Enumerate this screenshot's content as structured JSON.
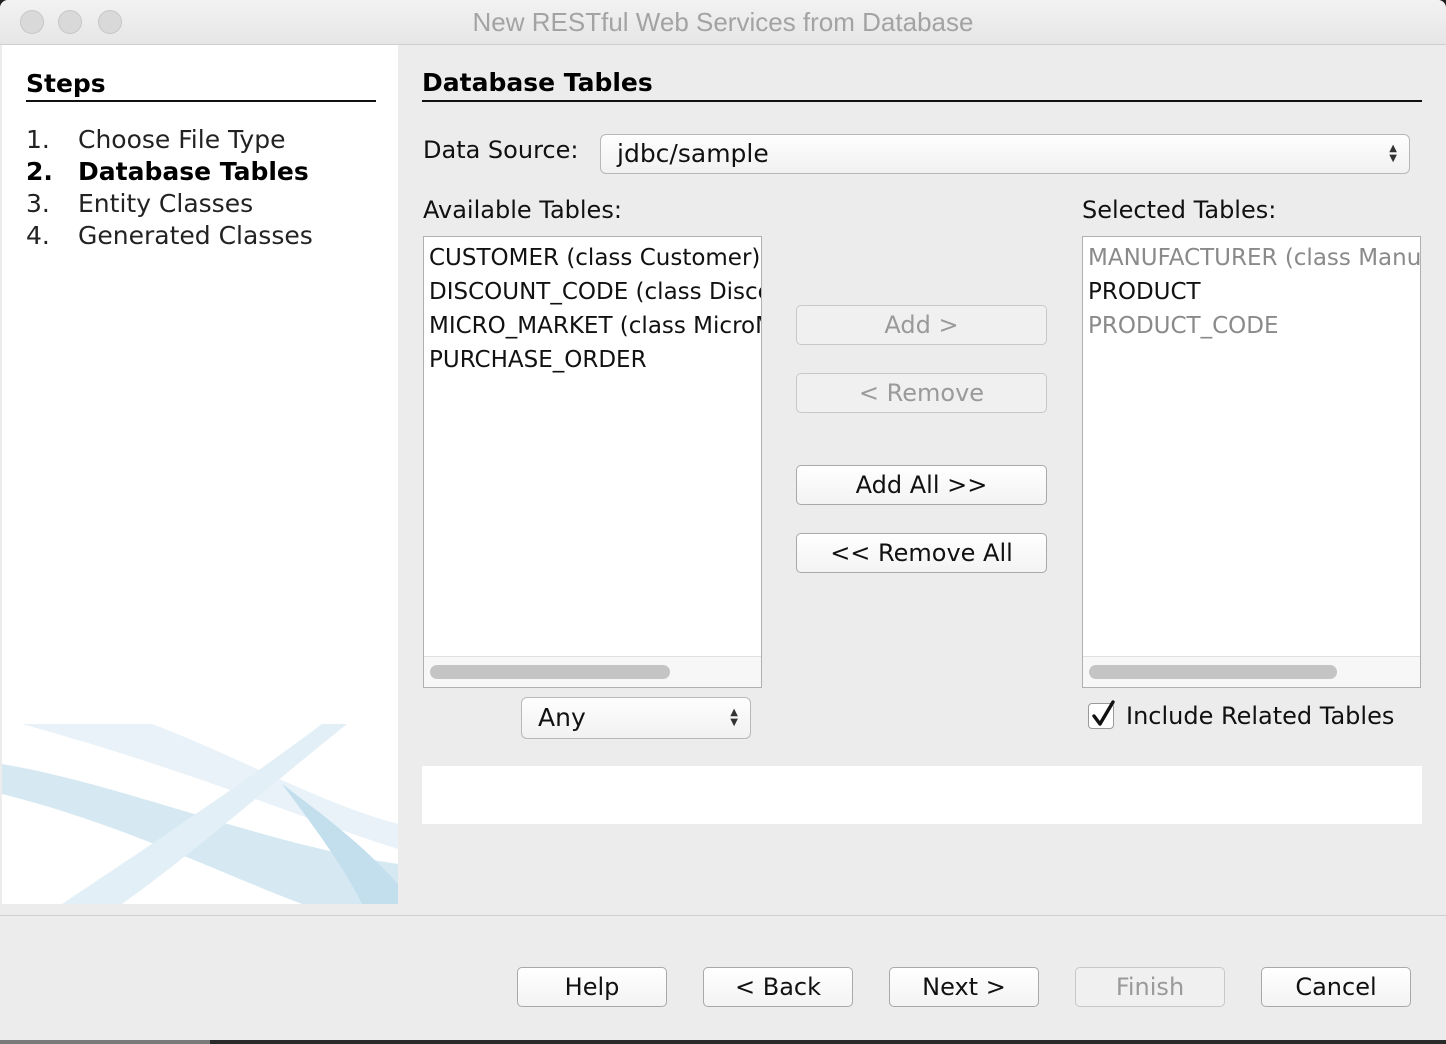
{
  "window": {
    "title": "New RESTful Web Services from Database"
  },
  "steps": {
    "title": "Steps",
    "items": [
      {
        "num": "1.",
        "label": "Choose File Type",
        "active": false
      },
      {
        "num": "2.",
        "label": "Database Tables",
        "active": true
      },
      {
        "num": "3.",
        "label": "Entity Classes",
        "active": false
      },
      {
        "num": "4.",
        "label": "Generated Classes",
        "active": false
      }
    ]
  },
  "main": {
    "title": "Database Tables",
    "data_source": {
      "label": "Data Source:",
      "value": "jdbc/sample"
    },
    "available": {
      "label": "Available Tables:",
      "items": [
        "CUSTOMER (class Customer)",
        "DISCOUNT_CODE (class Discount",
        "MICRO_MARKET (class MicroMarket)",
        "PURCHASE_ORDER"
      ],
      "filter": "Any"
    },
    "selected": {
      "label": "Selected Tables:",
      "items": [
        {
          "text": "MANUFACTURER (class Manufacturer)",
          "dim": true
        },
        {
          "text": "PRODUCT",
          "dim": false
        },
        {
          "text": "PRODUCT_CODE",
          "dim": true
        }
      ],
      "include_related": {
        "label": "Include Related Tables",
        "checked": true
      }
    },
    "buttons": {
      "add": "Add >",
      "remove": "< Remove",
      "add_all": "Add All >>",
      "remove_all": "<< Remove All"
    }
  },
  "footer": {
    "help": "Help",
    "back": "< Back",
    "next": "Next >",
    "finish": "Finish",
    "cancel": "Cancel"
  }
}
